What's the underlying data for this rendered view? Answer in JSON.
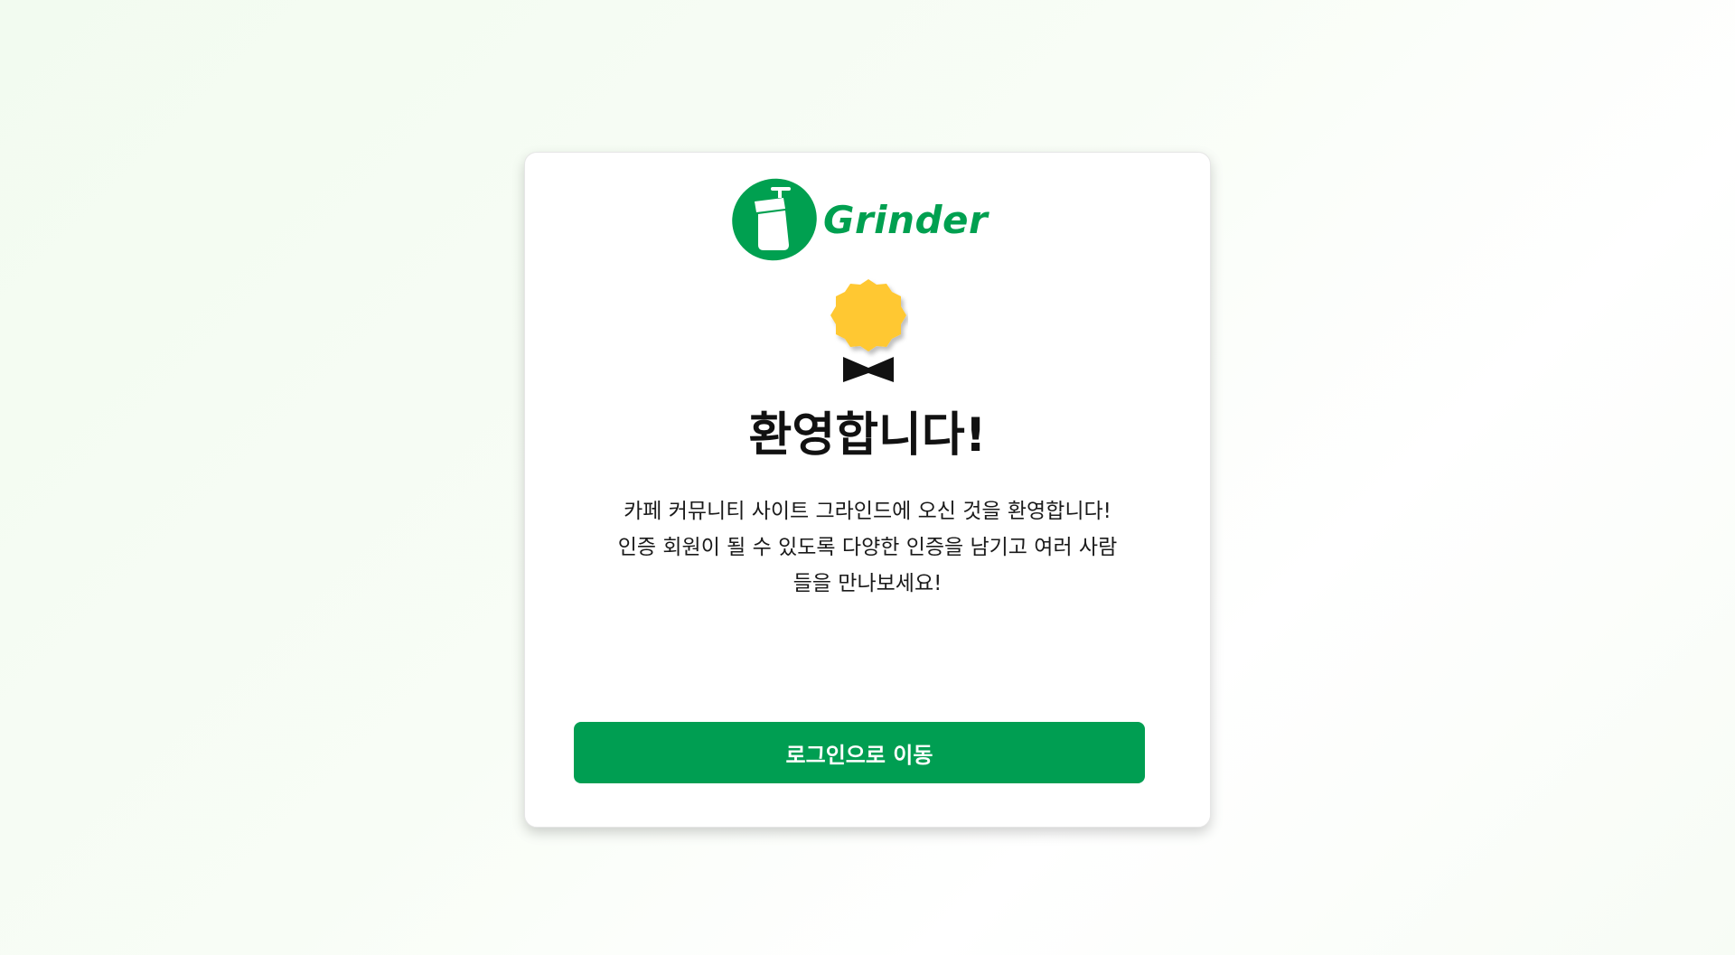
{
  "logo": {
    "text": "Grinder",
    "icon": "coffee-grinder-icon",
    "color": "#00a050"
  },
  "badge": {
    "icon": "award-badge-icon",
    "color": "#ffc832"
  },
  "welcome": {
    "title": "환영합니다!",
    "line1": "카페 커뮤니티 사이트 그라인드에 오신 것을 환영합니다!",
    "line2": "인증 회원이 될 수 있도록 다양한 인증을 남기고 여러 사람",
    "line3": "들을 만나보세요!"
  },
  "actions": {
    "login_label": "로그인으로 이동",
    "button_color": "#009e52"
  }
}
